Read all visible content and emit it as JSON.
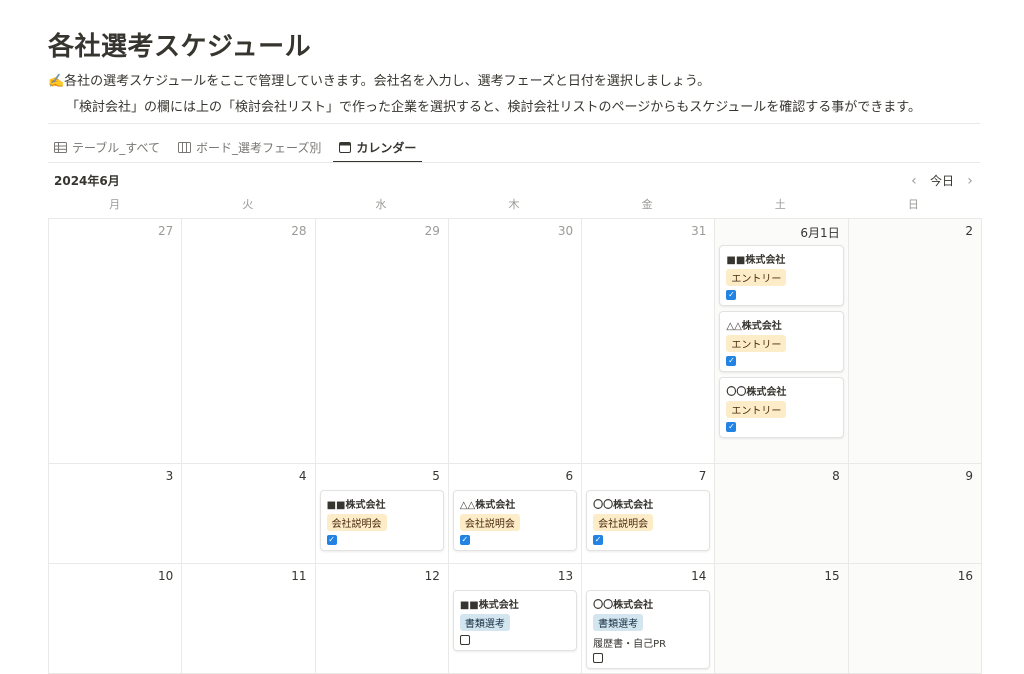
{
  "page": {
    "title": "各社選考スケジュール",
    "desc1": "✍️各社の選考スケジュールをここで管理していきます。会社名を入力し、選考フェーズと日付を選択しましょう。",
    "desc2": "「検討会社」の欄には上の「検討会社リスト」で作った企業を選択すると、検討会社リストのページからもスケジュールを確認する事ができます。"
  },
  "tabs": [
    {
      "label": "テーブル_すべて",
      "icon": "table-icon"
    },
    {
      "label": "ボード_選考フェーズ別",
      "icon": "board-icon"
    },
    {
      "label": "カレンダー",
      "icon": "calendar-icon",
      "active": true
    }
  ],
  "calendar": {
    "month_label": "2024年6月",
    "today_label": "今日",
    "weekdays": [
      "月",
      "火",
      "水",
      "木",
      "金",
      "土",
      "日"
    ],
    "colors": {
      "checkbox": "#2383e2",
      "tag_orange": "#fdecc8",
      "tag_blue": "#d3e5ef"
    },
    "weeks": [
      {
        "height": 245,
        "days": [
          {
            "label": "27",
            "dim": true,
            "events": []
          },
          {
            "label": "28",
            "dim": true,
            "events": []
          },
          {
            "label": "29",
            "dim": true,
            "events": []
          },
          {
            "label": "30",
            "dim": true,
            "events": []
          },
          {
            "label": "31",
            "dim": true,
            "events": []
          },
          {
            "label": "6月1日",
            "weekend": true,
            "events": [
              {
                "name": "■■株式会社",
                "tag": "エントリー",
                "tag_color": "orange",
                "checked": true
              },
              {
                "name": "△△株式会社",
                "tag": "エントリー",
                "tag_color": "orange",
                "checked": true
              },
              {
                "name": "〇〇株式会社",
                "tag": "エントリー",
                "tag_color": "orange",
                "checked": true
              }
            ]
          },
          {
            "label": "2",
            "weekend": true,
            "events": []
          }
        ]
      },
      {
        "height": 100,
        "days": [
          {
            "label": "3",
            "events": []
          },
          {
            "label": "4",
            "events": []
          },
          {
            "label": "5",
            "events": [
              {
                "name": "■■株式会社",
                "tag": "会社説明会",
                "tag_color": "orange",
                "checked": true
              }
            ]
          },
          {
            "label": "6",
            "events": [
              {
                "name": "△△株式会社",
                "tag": "会社説明会",
                "tag_color": "orange",
                "checked": true
              }
            ]
          },
          {
            "label": "7",
            "events": [
              {
                "name": "〇〇株式会社",
                "tag": "会社説明会",
                "tag_color": "orange",
                "checked": true
              }
            ]
          },
          {
            "label": "8",
            "weekend": true,
            "events": []
          },
          {
            "label": "9",
            "weekend": true,
            "events": []
          }
        ]
      },
      {
        "height": 110,
        "days": [
          {
            "label": "10",
            "events": []
          },
          {
            "label": "11",
            "events": []
          },
          {
            "label": "12",
            "events": []
          },
          {
            "label": "13",
            "events": [
              {
                "name": "■■株式会社",
                "tag": "書類選考",
                "tag_color": "blue",
                "checked": false
              }
            ]
          },
          {
            "label": "14",
            "events": [
              {
                "name": "〇〇株式会社",
                "tag": "書類選考",
                "tag_color": "blue",
                "note": "履歴書・自己PR",
                "checked": false
              }
            ]
          },
          {
            "label": "15",
            "weekend": true,
            "events": []
          },
          {
            "label": "16",
            "weekend": true,
            "events": []
          }
        ]
      }
    ]
  }
}
